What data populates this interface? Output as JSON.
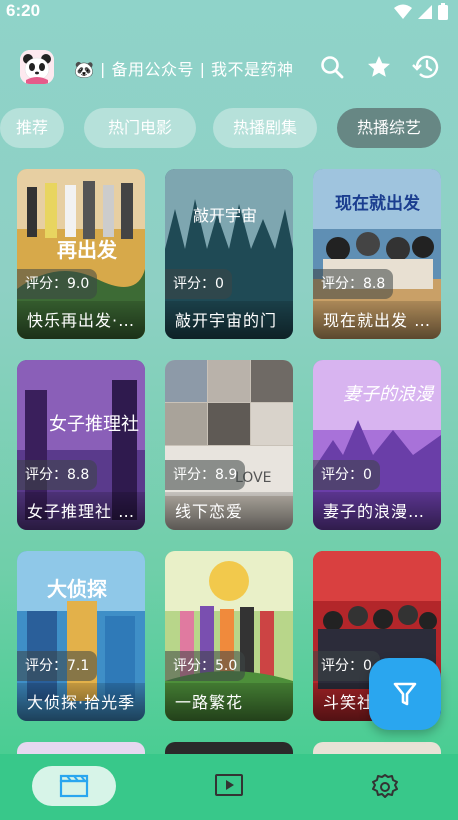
{
  "status_bar": {
    "time": "6:20"
  },
  "header": {
    "title": "🐼 | 备用公众号 | 我不是药神",
    "avatar_icon": "panda-avatar-icon",
    "search_icon": "search-icon",
    "favorite_icon": "star-icon",
    "history_icon": "history-icon"
  },
  "tabs": [
    {
      "label": "推荐",
      "active": false
    },
    {
      "label": "热门电影",
      "active": false
    },
    {
      "label": "热播剧集",
      "active": false
    },
    {
      "label": "热播综艺",
      "active": true
    }
  ],
  "cards": [
    {
      "rating": "评分：9.0",
      "title": "快乐再出发·最终季"
    },
    {
      "rating": "评分：0",
      "title": "敲开宇宙的门"
    },
    {
      "rating": "评分：8.8",
      "title": "现在就出发 第二季"
    },
    {
      "rating": "评分：8.8",
      "title": "女子推理社 第二季"
    },
    {
      "rating": "评分：8.9",
      "title": "线下恋爱"
    },
    {
      "rating": "评分：0",
      "title": "妻子的浪漫旅行"
    },
    {
      "rating": "评分：7.1",
      "title": "大侦探·拾光季"
    },
    {
      "rating": "评分：5.0",
      "title": "一路繁花"
    },
    {
      "rating": "评分：0",
      "title": "斗笑社 第二季"
    }
  ],
  "fab": {
    "icon": "filter-icon"
  },
  "bottom_nav": [
    {
      "icon": "movie-clapper-icon",
      "active": true
    },
    {
      "icon": "play-video-icon",
      "active": false
    },
    {
      "icon": "settings-gear-icon",
      "active": false
    }
  ],
  "colors": {
    "accent": "#2aa6ef",
    "nav_bg": "#38c88a",
    "active_tab": "#5a6e6e"
  }
}
